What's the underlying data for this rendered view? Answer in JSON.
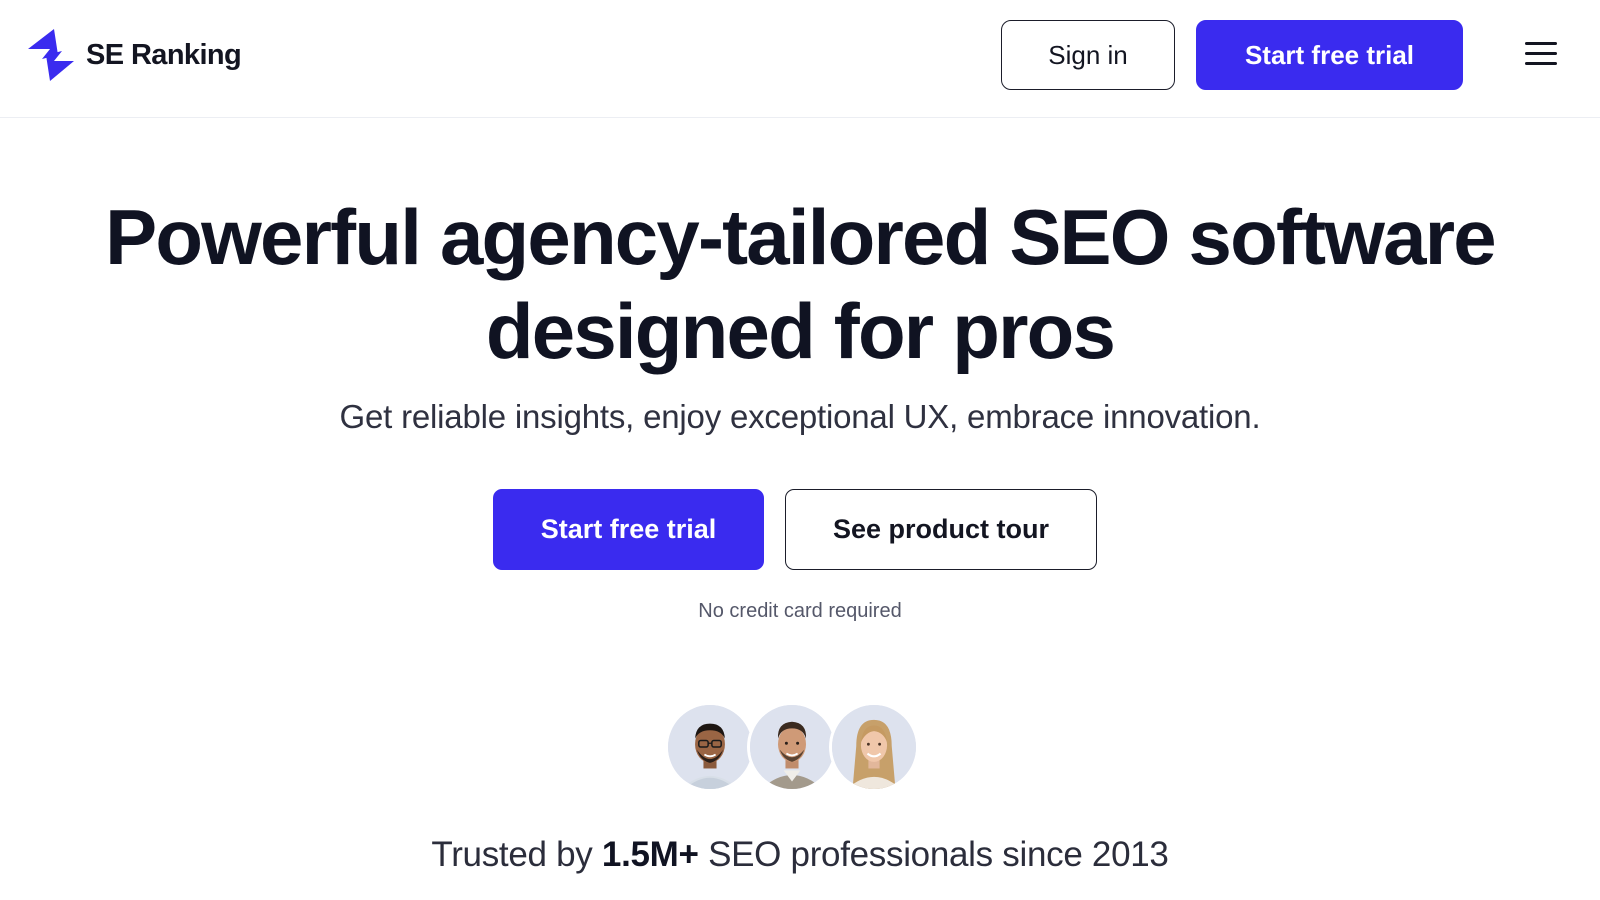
{
  "header": {
    "brand": "SE Ranking",
    "sign_in_label": "Sign in",
    "start_trial_label": "Start free trial",
    "menu_icon": "hamburger-menu-icon"
  },
  "hero": {
    "title_line1": "Powerful agency-tailored SEO software",
    "title_line2": "designed for pros",
    "subtitle": "Get reliable insights, enjoy exceptional UX, embrace innovation.",
    "primary_cta_label": "Start free trial",
    "secondary_cta_label": "See product tour",
    "note": "No credit card required"
  },
  "trust": {
    "avatars": [
      "person-1-avatar",
      "person-2-avatar",
      "person-3-avatar"
    ],
    "prefix": "Trusted by",
    "highlight": "1.5M+",
    "suffix": "SEO professionals since 2013"
  },
  "colors": {
    "brand": "#3a2bef",
    "text": "#101322"
  }
}
